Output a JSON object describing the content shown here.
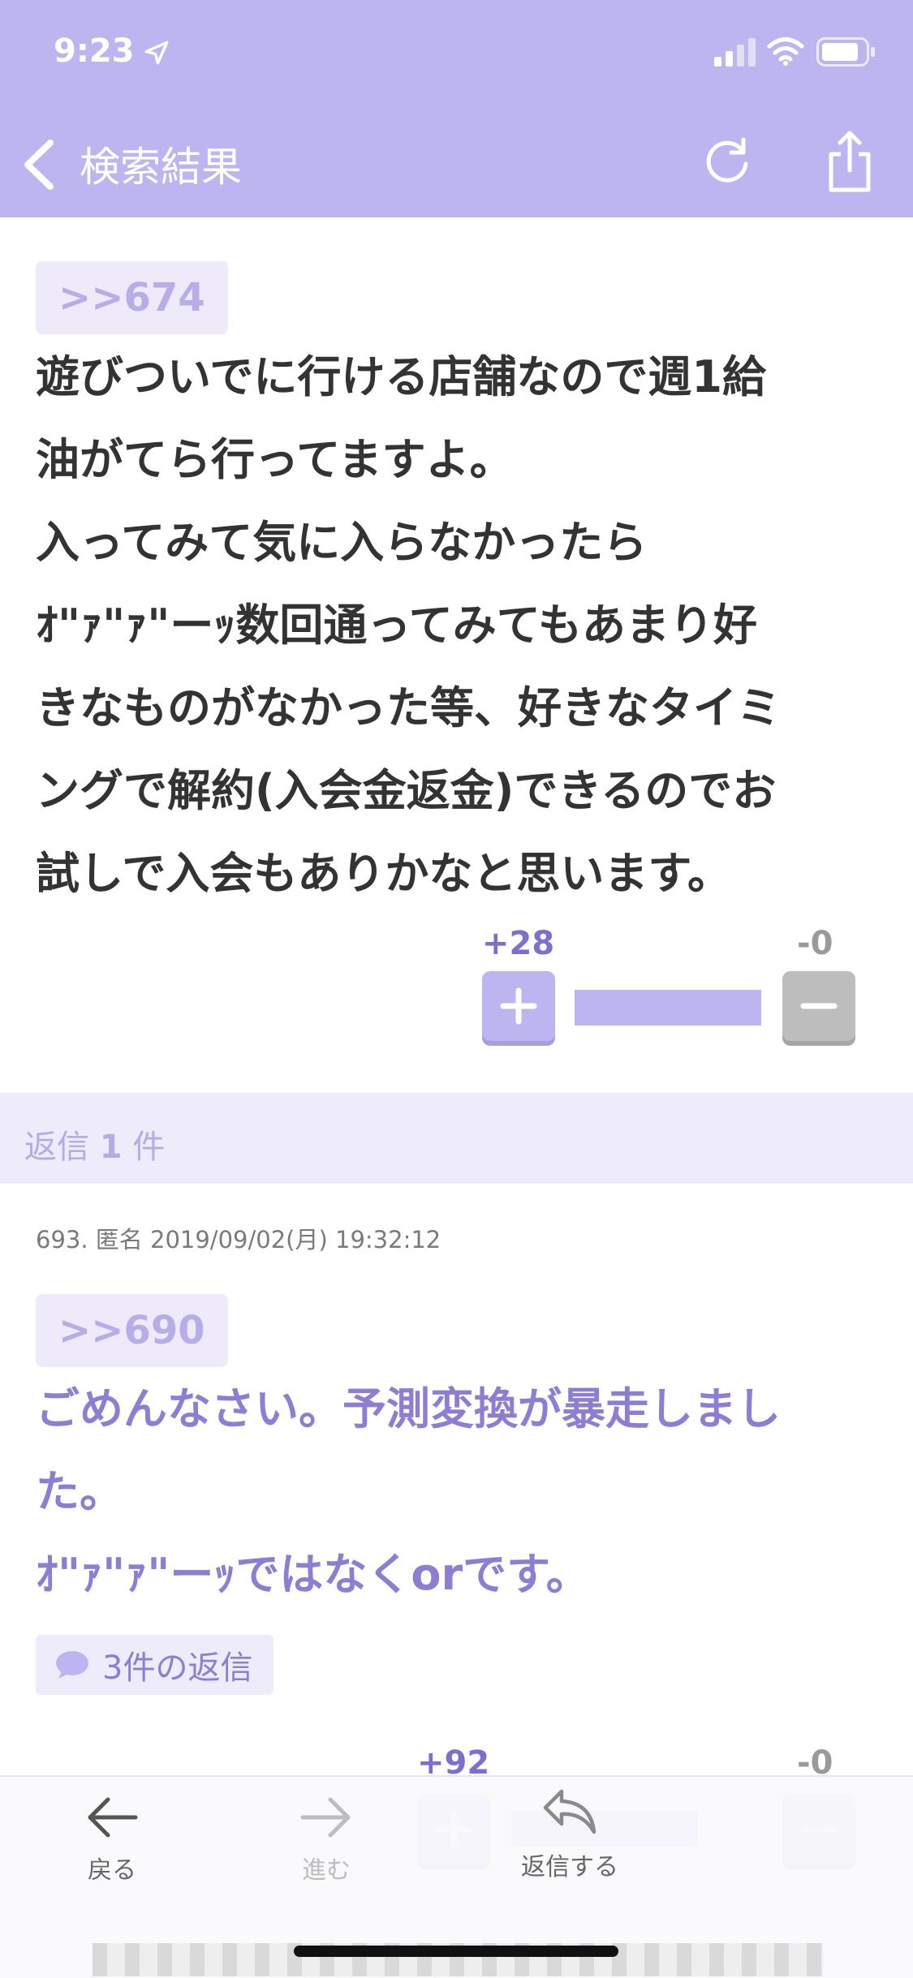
{
  "status_bar": {
    "time": "9:23"
  },
  "nav": {
    "title": "検索結果"
  },
  "post1": {
    "anchor": ">>674",
    "body": "遊びついでに行ける店舗なので週1給\n油がてら行ってますよ。\n入ってみて気に入らなかったら\nｵ\"ｧ\"ｧ\"ーｯ数回通ってみてもあまり好\nきなものがなかった等、好きなタイミ\nングで解約(入会金返金)できるのでお\n試しで入会もありかなと思います。",
    "plus_votes": "+28",
    "minus_votes": "-0",
    "plus_share": 1.0
  },
  "reply_header": {
    "prefix": "返信 ",
    "count": "1",
    "suffix": " 件"
  },
  "post2": {
    "meta": "693. 匿名 2019/09/02(月) 19:32:12",
    "anchor": ">>690",
    "body": "ごめんなさい。予測変換が暴走しまし\nた。\nｵ\"ｧ\"ｧ\"ーｯではなくorです。",
    "replies_label": "3件の返信",
    "plus_votes": "+92",
    "minus_votes": "-0",
    "plus_share": 1.0
  },
  "toolbar": {
    "back_label": "戻る",
    "forward_label": "進む",
    "reply_label": "返信する"
  },
  "colors": {
    "accent": "#BDB5EF",
    "accent_dark": "#7D6FCF",
    "reply_text": "#8E7ED3"
  }
}
